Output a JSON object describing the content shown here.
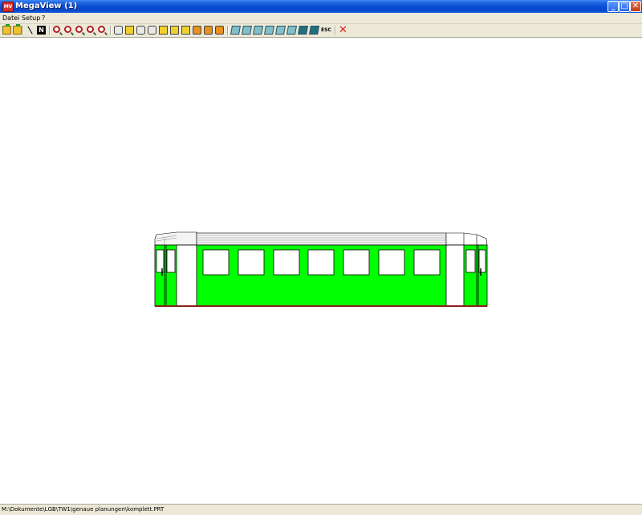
{
  "window": {
    "title": "MegaView (1)",
    "app_icon_label": "MV",
    "minimize_glyph": "_",
    "maximize_glyph": "□",
    "close_glyph": "✕"
  },
  "menu": {
    "items": [
      {
        "label": "Datei"
      },
      {
        "label": "Setup"
      },
      {
        "label": "?"
      }
    ]
  },
  "toolbar": {
    "buttons": [
      {
        "name": "open-folder-icon",
        "kind": "folder"
      },
      {
        "name": "save-folder-icon",
        "kind": "folder"
      },
      {
        "name": "line-tool-icon",
        "kind": "slash"
      },
      {
        "name": "n-tool-icon",
        "kind": "nbox",
        "label": "N"
      },
      {
        "name": "zoom-in-icon",
        "kind": "mag"
      },
      {
        "name": "zoom-out-icon",
        "kind": "mag"
      },
      {
        "name": "zoom-prev-icon",
        "kind": "mag"
      },
      {
        "name": "zoom-window-icon",
        "kind": "mag"
      },
      {
        "name": "zoom-all-icon",
        "kind": "mag"
      },
      {
        "name": "cylinder-icon",
        "kind": "cyl"
      },
      {
        "name": "view-1-icon",
        "kind": "hex"
      },
      {
        "name": "view-2-icon",
        "kind": "cyl"
      },
      {
        "name": "view-3-icon",
        "kind": "cyl"
      },
      {
        "name": "view-4-icon",
        "kind": "hex"
      },
      {
        "name": "view-5-icon",
        "kind": "hex"
      },
      {
        "name": "view-6-icon",
        "kind": "hex"
      },
      {
        "name": "view-7-icon",
        "kind": "cat"
      },
      {
        "name": "view-8-icon",
        "kind": "cat"
      },
      {
        "name": "view-9-icon",
        "kind": "cat"
      },
      {
        "name": "iso-1-icon",
        "kind": "cube"
      },
      {
        "name": "iso-2-icon",
        "kind": "cube"
      },
      {
        "name": "iso-3-icon",
        "kind": "cube"
      },
      {
        "name": "iso-4-icon",
        "kind": "cube"
      },
      {
        "name": "iso-5-icon",
        "kind": "cube"
      },
      {
        "name": "iso-6-icon",
        "kind": "cube"
      },
      {
        "name": "iso-7-icon",
        "kind": "cube dark"
      },
      {
        "name": "iso-8-icon",
        "kind": "cube dark"
      },
      {
        "name": "esc-icon",
        "kind": "esc",
        "label": "ESC"
      },
      {
        "name": "close-red-icon",
        "kind": "xclose",
        "label": "✕"
      }
    ]
  },
  "status": {
    "path": "M:\\Dokumente\\LGB\\TW1\\genaue planungen\\komplett.PRT"
  },
  "colors": {
    "car_body": "#00ff00",
    "outline": "#000000",
    "roof": "#e8e8e8",
    "underframe": "#8b2020"
  }
}
